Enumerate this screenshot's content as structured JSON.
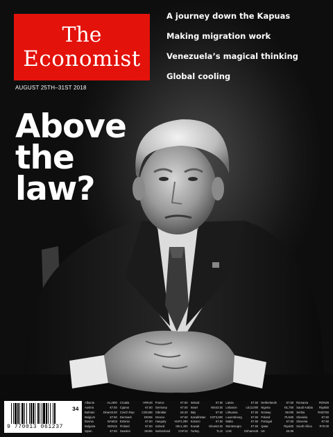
{
  "masthead": {
    "line1": "The",
    "line2": "Economist"
  },
  "dateline": "AUGUST 25TH–31ST 2018",
  "headlines": [
    "A journey down the Kapuas",
    "Making migration work",
    "Venezuela’s magical thinking",
    "Global cooling"
  ],
  "cover_title": [
    "Above",
    "the",
    "law?"
  ],
  "portrait": {
    "subject": "seated-man-portrait",
    "tone": "monochrome"
  },
  "side_code": "issn",
  "prices": [
    {
      "c": "Albania",
      "p": "ALL900"
    },
    {
      "c": "Croatia",
      "p": "HRK48"
    },
    {
      "c": "France",
      "p": "€7.50"
    },
    {
      "c": "Ireland",
      "p": "€7.50"
    },
    {
      "c": "Latvia",
      "p": "€7.50"
    },
    {
      "c": "Netherlands",
      "p": "€7.50"
    },
    {
      "c": "Romania",
      "p": "RON29"
    },
    {
      "c": "Austria",
      "p": "€7.50"
    },
    {
      "c": "Cyprus",
      "p": "€7.50"
    },
    {
      "c": "Germany",
      "p": "€7.50"
    },
    {
      "c": "Israel",
      "p": "NIS43.00"
    },
    {
      "c": "Lebanon",
      "p": "LE13,000"
    },
    {
      "c": "Nigeria",
      "p": "N1,750"
    },
    {
      "c": "Saudi Arabia",
      "p": "Riyal50"
    },
    {
      "c": "Bahrain",
      "p": "Dinars3.50"
    },
    {
      "c": "Czech Rep",
      "p": "CZK198"
    },
    {
      "c": "Gibraltar",
      "p": "£6.20"
    },
    {
      "c": "Italy",
      "p": "€7.50"
    },
    {
      "c": "Lithuania",
      "p": "€7.50"
    },
    {
      "c": "Norway",
      "p": "NKr90"
    },
    {
      "c": "Serbia",
      "p": "RSD750"
    },
    {
      "c": "Belgium",
      "p": "€7.50"
    },
    {
      "c": "Denmark",
      "p": "DKr55"
    },
    {
      "c": "Greece",
      "p": "€7.50"
    },
    {
      "c": "Kazakhstan",
      "p": "KZT3,800"
    },
    {
      "c": "Luxembourg",
      "p": "€7.50"
    },
    {
      "c": "Poland",
      "p": "PLN30"
    },
    {
      "c": "Slovakia",
      "p": "€7.50"
    },
    {
      "c": "Bosnia",
      "p": "BAM18"
    },
    {
      "c": "Estonia",
      "p": "€7.50"
    },
    {
      "c": "Hungary",
      "p": "HUF2,290"
    },
    {
      "c": "Kosovo",
      "p": "€7.50"
    },
    {
      "c": "Malta",
      "p": "€7.50"
    },
    {
      "c": "Portugal",
      "p": "€7.50"
    },
    {
      "c": "Slovenia",
      "p": "€7.50"
    },
    {
      "c": "Bulgaria",
      "p": "BGN15"
    },
    {
      "c": "Finland",
      "p": "€7.50"
    },
    {
      "c": "Iceland",
      "p": "ISK1,400"
    },
    {
      "c": "Kuwait",
      "p": "Dinars3.00"
    },
    {
      "c": "Montenegro",
      "p": "€7.50"
    },
    {
      "c": "Qatar",
      "p": "Riyal40"
    },
    {
      "c": "South Africa",
      "p": "R70.00"
    },
    {
      "c": "Spain",
      "p": "€7.50"
    },
    {
      "c": "Sweden",
      "p": "SKr95"
    },
    {
      "c": "Switzerland",
      "p": "CHF10"
    },
    {
      "c": "Turkey",
      "p": "TL10"
    },
    {
      "c": "UAE",
      "p": "Dirhams45"
    },
    {
      "c": "UK",
      "p": "£5.99"
    },
    {
      "c": "",
      "p": ""
    }
  ],
  "barcode": {
    "digits": "9 770013 061237",
    "issue": "34"
  },
  "colors": {
    "brand_red": "#e3120b",
    "text": "#ffffff"
  }
}
